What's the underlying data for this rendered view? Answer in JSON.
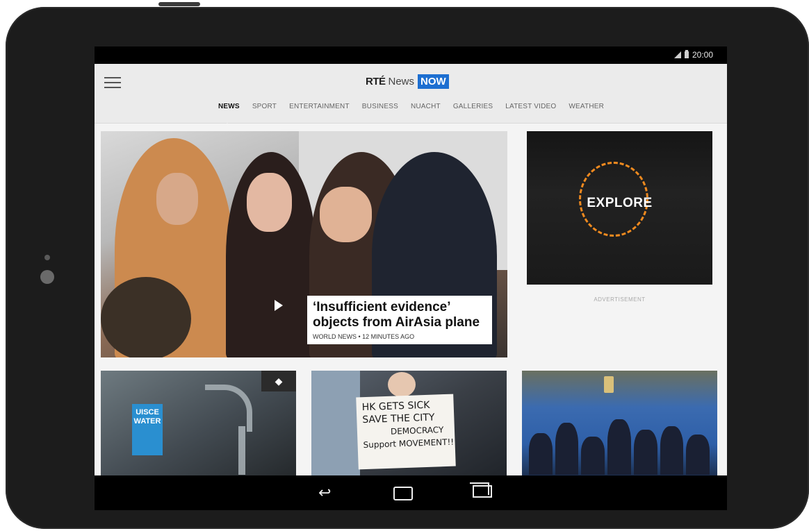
{
  "status_bar": {
    "time": "20:00"
  },
  "header": {
    "logo_rte": "RTÉ",
    "logo_news": "News",
    "logo_now": "NOW",
    "nav": [
      "NEWS",
      "SPORT",
      "ENTERTAINMENT",
      "BUSINESS",
      "NUACHT",
      "GALLERIES",
      "LATEST VIDEO",
      "WEATHER"
    ],
    "active_nav": "NEWS"
  },
  "hero": {
    "title": "‘Insufficient evidence’ objects from AirAsia plane",
    "meta": "WORLD NEWS • 12 MINUTES AGO"
  },
  "ad": {
    "text": "EXPLORE",
    "label": "ADVERTISEMENT"
  },
  "tiles": {
    "water": {
      "sign": "UISCE WATER"
    },
    "protest": {
      "sign_lines": [
        "HK GETS SICK",
        "SAVE THE CITY",
        "DEMOCRACY",
        "Support MOVEMENT!!"
      ]
    }
  },
  "system_nav": {
    "back": "back",
    "home": "home",
    "recents": "recents"
  },
  "colors": {
    "accent": "#1d6fd1",
    "explore_ring": "#f08a1f"
  }
}
